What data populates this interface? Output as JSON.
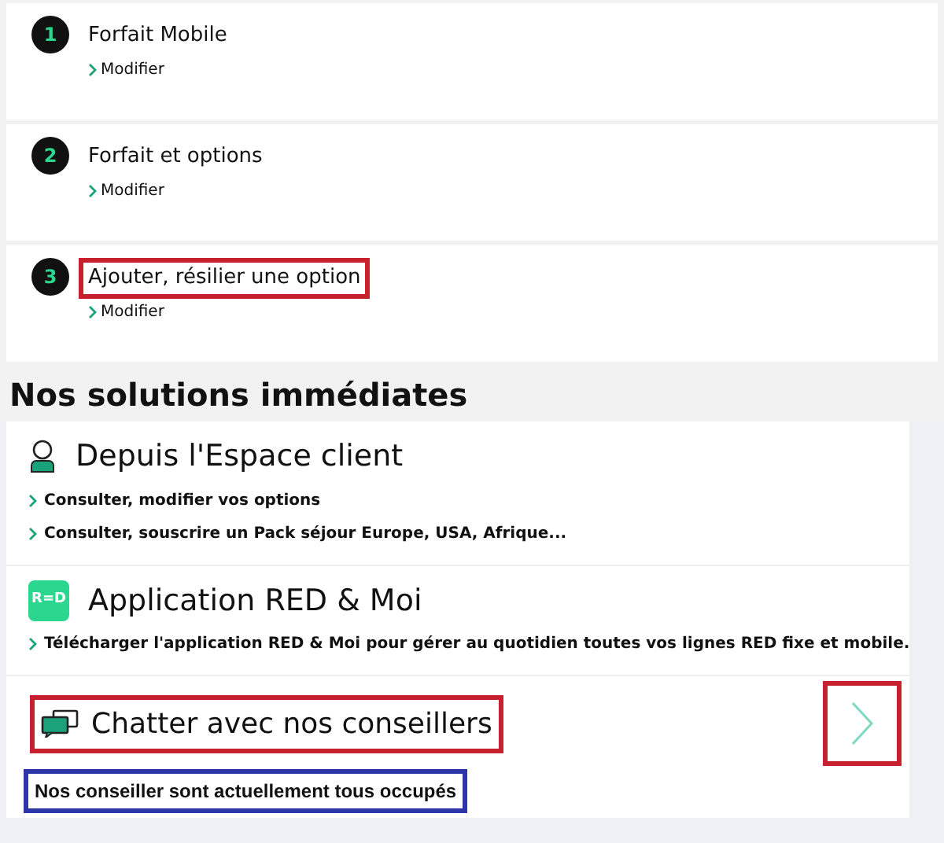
{
  "steps": [
    {
      "number": "1",
      "title": "Forfait Mobile",
      "link": "Modifier",
      "highlighted": false
    },
    {
      "number": "2",
      "title": "Forfait et options",
      "link": "Modifier",
      "highlighted": false
    },
    {
      "number": "3",
      "title": "Ajouter, résilier une option",
      "link": "Modifier",
      "highlighted": true
    }
  ],
  "heading": "Nos solutions immédiates",
  "solutions": [
    {
      "kind": "account",
      "title": "Depuis l'Espace client",
      "links": [
        "Consulter, modifier vos options",
        "Consulter, souscrire un Pack séjour Europe, USA, Afrique..."
      ]
    },
    {
      "kind": "app",
      "logo_text": "R=D",
      "title": "Application RED & Moi",
      "links": [
        "Télécharger l'application RED & Moi pour gérer au quotidien toutes vos lignes RED fixe et mobile."
      ]
    }
  ],
  "chat": {
    "title": "Chatter avec nos conseillers",
    "title_highlighted": true,
    "arrow_highlighted": true,
    "status": "Nos conseiller sont actuellement tous occupés",
    "status_highlighted": true
  }
}
